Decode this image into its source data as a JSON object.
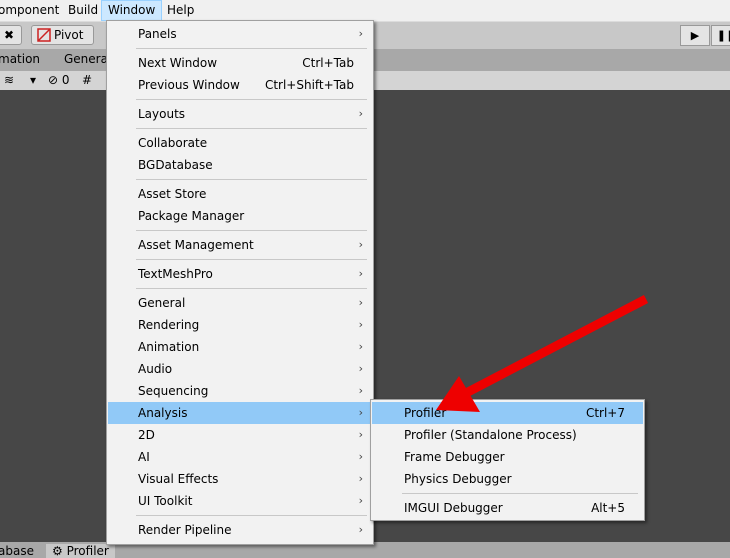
{
  "menubar": {
    "items": [
      "omponent",
      "Build",
      "Window",
      "Help"
    ]
  },
  "toolbar": {
    "pivot_label": "Pivot"
  },
  "tabs": {
    "animation": "mation",
    "general": "Genera"
  },
  "scene_toolbar": {
    "hidden_count": "0"
  },
  "bottom_tabs": {
    "database": "abase",
    "profiler": "Profiler"
  },
  "window_menu": {
    "panels": "Panels",
    "next_window": "Next Window",
    "next_window_sc": "Ctrl+Tab",
    "prev_window": "Previous Window",
    "prev_window_sc": "Ctrl+Shift+Tab",
    "layouts": "Layouts",
    "collaborate": "Collaborate",
    "bgdatabase": "BGDatabase",
    "asset_store": "Asset Store",
    "package_manager": "Package Manager",
    "asset_management": "Asset Management",
    "textmeshpro": "TextMeshPro",
    "general": "General",
    "rendering": "Rendering",
    "animation": "Animation",
    "audio": "Audio",
    "sequencing": "Sequencing",
    "analysis": "Analysis",
    "twod": "2D",
    "ai": "AI",
    "visual_effects": "Visual Effects",
    "ui_toolkit": "UI Toolkit",
    "render_pipeline": "Render Pipeline"
  },
  "analysis_menu": {
    "profiler": "Profiler",
    "profiler_sc": "Ctrl+7",
    "profiler_standalone": "Profiler (Standalone Process)",
    "frame_debugger": "Frame Debugger",
    "physics_debugger": "Physics Debugger",
    "imgui_debugger": "IMGUI Debugger",
    "imgui_debugger_sc": "Alt+5"
  },
  "colors": {
    "highlight": "#91c9f7",
    "arrow": "#ee0000"
  }
}
